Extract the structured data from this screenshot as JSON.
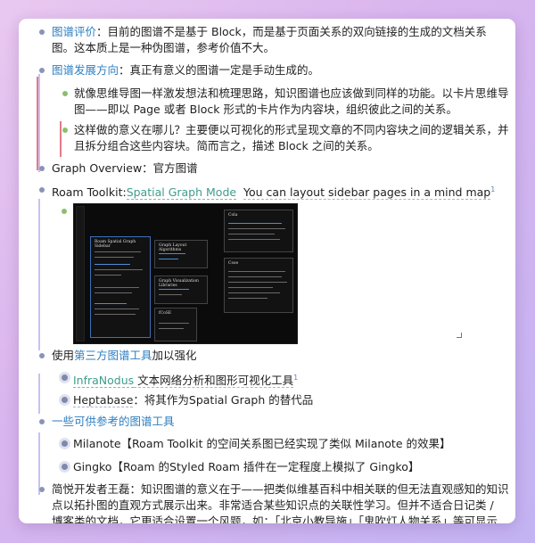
{
  "items": {
    "graph_eval": {
      "label": "图谱评价",
      "line1": "：目前的图谱不是基于 Block，而是基于页面关系的双向链接的生成的文档关系",
      "line2": "图。这本质上是一种伪图谱，参考价值不大。"
    },
    "graph_dev": {
      "label": "图谱发展方向",
      "rest": "：真正有意义的图谱一定是手动生成的。"
    },
    "mindmap": {
      "line1": "就像思维导图一样激发想法和梳理思路，知识图谱也应该做到同样的功能。以卡片思维导",
      "line2": "图——即以 Page 或者 Block 形式的卡片作为内容块，组织彼此之间的关系。"
    },
    "meaning": {
      "line1": "这样做的意义在哪儿？主要便以可视化的形式呈现文章的不同内容块之间的逻辑关系，并",
      "line2": "且拆分组合这些内容块。简而言之，描述 Block 之间的关系。"
    },
    "overview": "Graph Overview：官方图谱",
    "toolkit": {
      "prefix": "Roam Toolkit:",
      "link1": "Spatial Graph Mode",
      "link2": "You can layout sidebar pages in a mind map",
      "footnote": "1"
    },
    "third_party": {
      "prefix": "使用",
      "link": "第三方图谱工具",
      "suffix": "加以强化"
    },
    "infranodus": {
      "link": "InfraNodus",
      "rest": " 文本网络分析和图形可视化工具",
      "footnote": "1"
    },
    "heptabase": {
      "link": "Heptabase",
      "rest": "：将其作为Spatial Graph 的替代品"
    },
    "ref_tools": "一些可供参考的图谱工具",
    "milanote": "Milanote【Roam Toolkit 的空间关系图已经实现了类似 Milanote 的效果】",
    "gingko": "Gingko【Roam 的Styled Roam 插件在一定程度上模拟了 Gingko】",
    "wanglei": {
      "line1": "简悦开发者王磊：知识图谱的意义在于——把类似维基百科中相关联的但无法直观感知的知识",
      "line2": "点以拓扑图的直观方式展示出来。非常适合某些知识点的关联性学习。但并不适合日记类 /",
      "line3": "博客类的文档，它更适合设置一个风题，如：「北京小教导施」「鬼吹灯人物关系」等可显示"
    }
  },
  "screenshot": {
    "card_title": "Roam Spatial Graph Sidebar",
    "node_a": "Graph Layout Algorithms",
    "node_b": "Graph Visualization Libraries",
    "node_c": "Cola",
    "node_d": "Cose",
    "node_e": "fCoSE"
  }
}
